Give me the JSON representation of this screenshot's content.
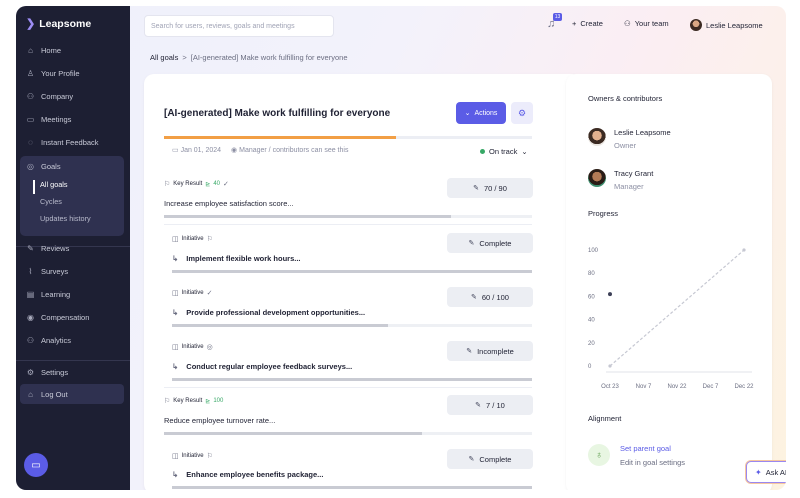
{
  "app": {
    "name": "Leapsome"
  },
  "sidebar": {
    "items": [
      {
        "label": "Home",
        "icon": "home-icon"
      },
      {
        "label": "Your Profile",
        "icon": "user-icon"
      },
      {
        "label": "Company",
        "icon": "people-icon"
      },
      {
        "label": "Meetings",
        "icon": "calendar-icon"
      },
      {
        "label": "Instant Feedback",
        "icon": "chat-icon"
      },
      {
        "label": "Goals",
        "icon": "target-icon"
      },
      {
        "label": "Reviews",
        "icon": "pen-icon"
      },
      {
        "label": "Surveys",
        "icon": "pulse-icon"
      },
      {
        "label": "Learning",
        "icon": "book-icon"
      },
      {
        "label": "Compensation",
        "icon": "money-icon"
      },
      {
        "label": "Analytics",
        "icon": "chart-icon"
      },
      {
        "label": "Settings",
        "icon": "gear-icon"
      },
      {
        "label": "Log Out",
        "icon": "lock-icon"
      }
    ],
    "goals_sub": [
      "All goals",
      "Cycles",
      "Updates history"
    ]
  },
  "topbar": {
    "search_placeholder": "Search for users, reviews, goals and meetings",
    "notification_count": "13",
    "create_label": "Create",
    "team_label": "Your team",
    "user_name": "Leslie Leapsome"
  },
  "breadcrumb": {
    "root": "All goals",
    "sep": ">",
    "current": "[AI-generated] Make work fulfilling for everyone"
  },
  "goal": {
    "title": "[AI-generated] Make work fulfilling for everyone",
    "actions_label": "Actions",
    "progress": 0.63,
    "date": "Jan 01, 2024",
    "visibility": "Manager / contributors can see this",
    "status": "On track"
  },
  "items": [
    {
      "kind": "Key Result",
      "metric": "40",
      "title": "Increase employee satisfaction score...",
      "value": "70 / 90",
      "progress": 0.78
    },
    {
      "kind": "Initiative",
      "title": "Implement flexible work hours...",
      "value": "Complete",
      "progress": 1.0
    },
    {
      "kind": "Initiative",
      "title": "Provide professional development opportunities...",
      "value": "60 / 100",
      "progress": 0.6
    },
    {
      "kind": "Initiative",
      "title": "Conduct regular employee feedback surveys...",
      "value": "Incomplete",
      "progress": 1.0
    },
    {
      "kind": "Key Result",
      "metric": "100",
      "title": "Reduce employee turnover rate...",
      "value": "7 / 10",
      "progress": 0.7
    },
    {
      "kind": "Initiative",
      "title": "Enhance employee benefits package...",
      "value": "Complete",
      "progress": 1.0
    }
  ],
  "side": {
    "owners_heading": "Owners & contributors",
    "people": [
      {
        "name": "Leslie Leapsome",
        "role": "Owner"
      },
      {
        "name": "Tracy Grant",
        "role": "Manager"
      }
    ],
    "progress_heading": "Progress",
    "alignment_heading": "Alignment",
    "set_parent": "Set parent goal",
    "edit_hint": "Edit in goal settings"
  },
  "chart_data": {
    "type": "line",
    "x": [
      "Oct 23",
      "Nov 7",
      "Nov 22",
      "Dec 7",
      "Dec 22"
    ],
    "yticks": [
      0,
      20,
      40,
      60,
      80,
      100
    ],
    "ylim": [
      0,
      100
    ],
    "series": [
      {
        "target_start": 0,
        "target_end": 100
      },
      {
        "current_point": {
          "x": "Oct 23",
          "y": 62
        }
      }
    ]
  },
  "ask_ai": "Ask AI"
}
